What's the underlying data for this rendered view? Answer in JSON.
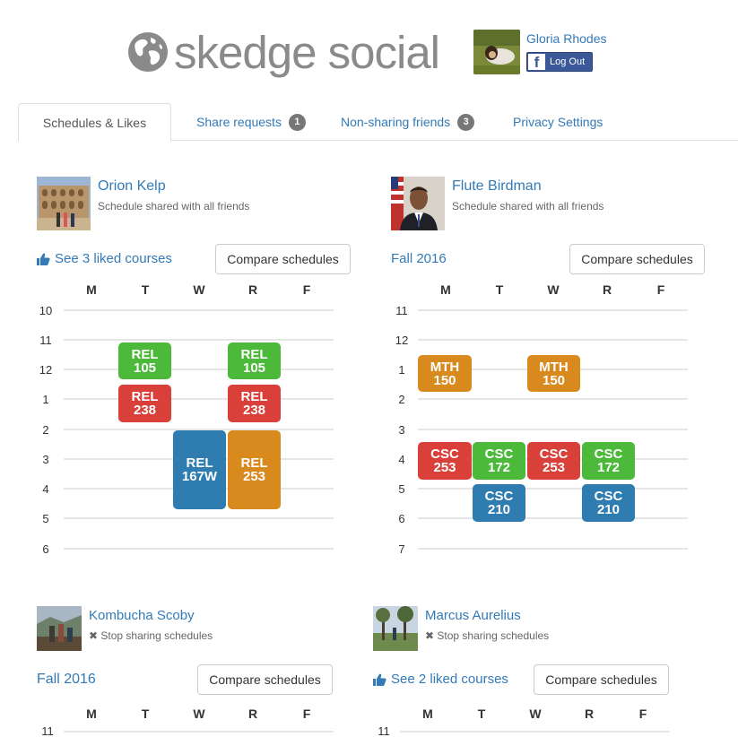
{
  "header": {
    "logo_text": "skedge social",
    "user_name": "Gloria Rhodes",
    "logout_label": "Log Out"
  },
  "tabs": [
    {
      "label": "Schedules & Likes",
      "active": true
    },
    {
      "label": "Share requests",
      "badge": "1"
    },
    {
      "label": "Non-sharing friends",
      "badge": "3"
    },
    {
      "label": "Privacy Settings"
    }
  ],
  "days": [
    "M",
    "T",
    "W",
    "R",
    "F"
  ],
  "colors": {
    "green": "#4cb93a",
    "red": "#d9403a",
    "blue": "#2f7cb0",
    "orange": "#d98a1f"
  },
  "friends": [
    {
      "name": "Orion Kelp",
      "share_text": "Schedule shared with all friends",
      "sub_label": "See 3 liked courses",
      "compare_label": "Compare schedules",
      "hours": [
        "10",
        "11",
        "12",
        "1",
        "2",
        "3",
        "4",
        "5",
        "6"
      ],
      "courses": [
        {
          "code": "REL",
          "num": "105",
          "color": "green"
        },
        {
          "code": "REL",
          "num": "105",
          "color": "green"
        },
        {
          "code": "REL",
          "num": "238",
          "color": "red"
        },
        {
          "code": "REL",
          "num": "238",
          "color": "red"
        },
        {
          "code": "REL",
          "num": "167W",
          "color": "blue"
        },
        {
          "code": "REL",
          "num": "253",
          "color": "orange"
        }
      ]
    },
    {
      "name": "Flute Birdman",
      "share_text": "Schedule shared with all friends",
      "sub_label": "Fall 2016",
      "compare_label": "Compare schedules",
      "hours": [
        "11",
        "12",
        "1",
        "2",
        "3",
        "4",
        "5",
        "6",
        "7"
      ],
      "courses": [
        {
          "code": "MTH",
          "num": "150",
          "color": "orange"
        },
        {
          "code": "MTH",
          "num": "150",
          "color": "orange"
        },
        {
          "code": "CSC",
          "num": "253",
          "color": "red"
        },
        {
          "code": "CSC",
          "num": "172",
          "color": "green"
        },
        {
          "code": "CSC",
          "num": "253",
          "color": "red"
        },
        {
          "code": "CSC",
          "num": "172",
          "color": "green"
        },
        {
          "code": "CSC",
          "num": "210",
          "color": "blue"
        },
        {
          "code": "CSC",
          "num": "210",
          "color": "blue"
        }
      ]
    },
    {
      "name": "Kombucha Scoby",
      "share_text": "Stop sharing schedules",
      "sub_label": "Fall 2016",
      "compare_label": "Compare schedules",
      "hours": [
        "11"
      ]
    },
    {
      "name": "Marcus Aurelius",
      "share_text": "Stop sharing schedules",
      "sub_label": "See 2 liked courses",
      "compare_label": "Compare schedules",
      "hours": [
        "11"
      ]
    }
  ]
}
